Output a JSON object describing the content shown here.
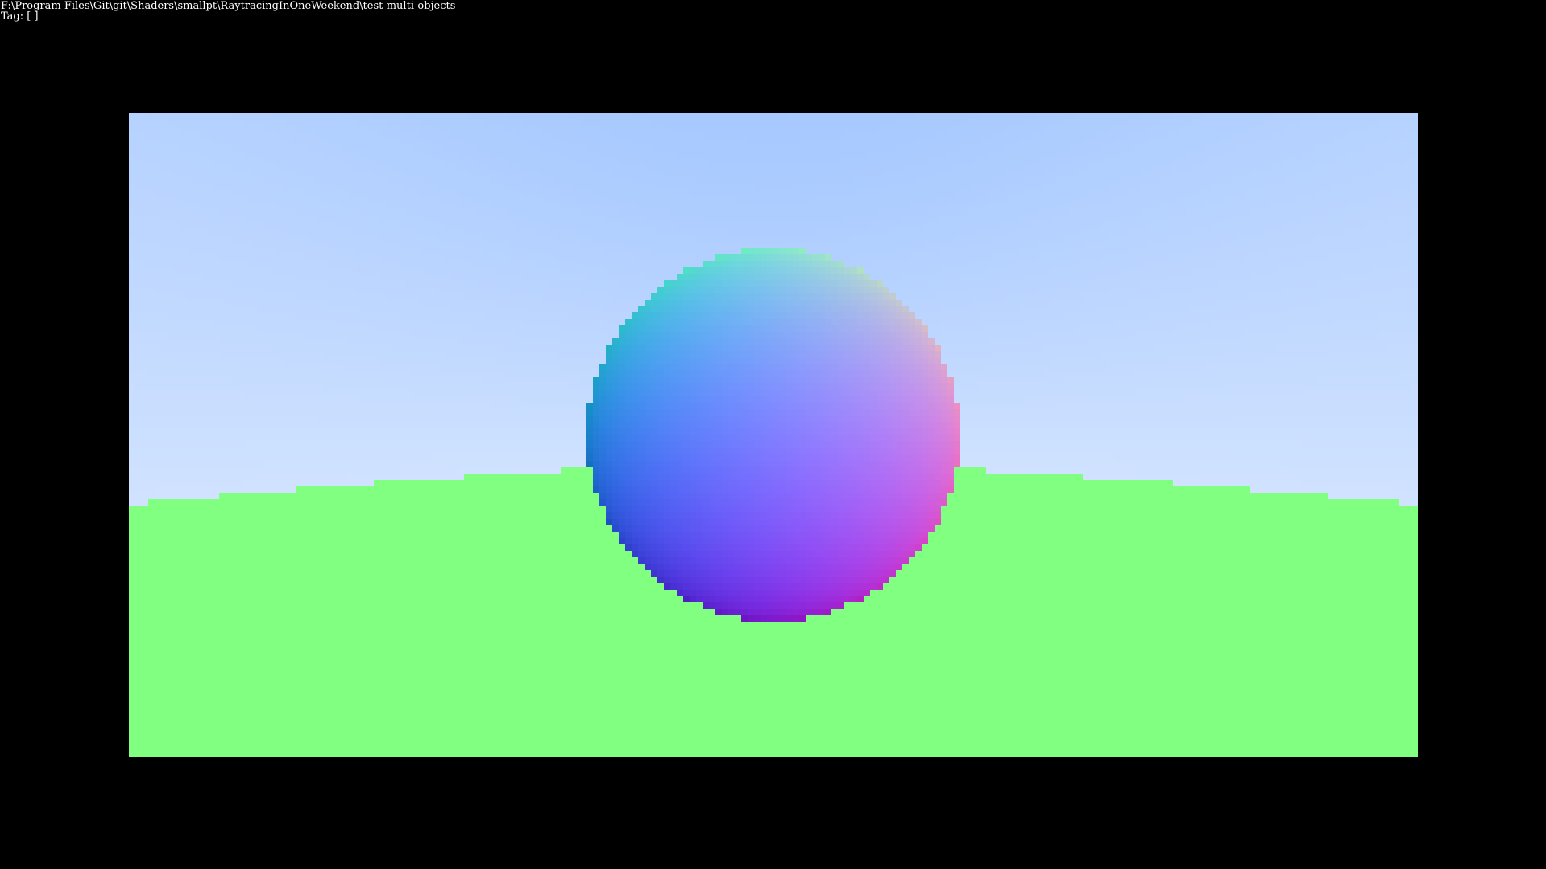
{
  "window": {
    "path": "F:\\Program Files\\Git\\git\\Shaders\\smallpt\\RaytracingInOneWeekend\\test-multi-objects",
    "tag_prefix": "Tag:",
    "tag_value": "[ ]"
  },
  "scene": {
    "background_color": "#000000",
    "sky_top_color": "#97bfff",
    "sky_horizon_color": "#ffffff",
    "ground_color": "#80ff80",
    "shading": "surface-normal",
    "objects": [
      "sphere",
      "ground-sphere"
    ]
  }
}
